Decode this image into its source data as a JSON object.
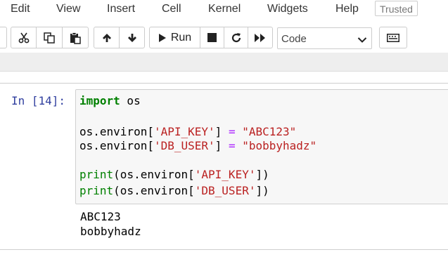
{
  "menu": {
    "items": [
      "Edit",
      "View",
      "Insert",
      "Cell",
      "Kernel",
      "Widgets",
      "Help"
    ],
    "trusted": "Trusted"
  },
  "toolbar": {
    "run_label": "Run",
    "cell_type": "Code",
    "icons": [
      "cut-icon",
      "copy-icon",
      "paste-icon",
      "move-up-icon",
      "move-down-icon",
      "run-icon",
      "stop-icon",
      "restart-icon",
      "fast-forward-icon",
      "keyboard-icon"
    ]
  },
  "cell": {
    "prompt": "In [14]:",
    "code": {
      "l1_kw": "import",
      "l1_rest": " os",
      "l2_a": "os.environ[",
      "l2_key": "'API_KEY'",
      "l2_b": "] ",
      "l2_eq": "=",
      "l2_sp": " ",
      "l2_val": "\"ABC123\"",
      "l3_a": "os.environ[",
      "l3_key": "'DB_USER'",
      "l3_b": "] ",
      "l3_eq": "=",
      "l3_sp": " ",
      "l3_val": "\"bobbyhadz\"",
      "l4_fn": "print",
      "l4_a": "(os.environ[",
      "l4_key": "'API_KEY'",
      "l4_b": "])",
      "l5_fn": "print",
      "l5_a": "(os.environ[",
      "l5_key": "'DB_USER'",
      "l5_b": "])"
    },
    "output": [
      "ABC123",
      "bobbyhadz"
    ]
  },
  "colors": {
    "keyword": "#008000",
    "string": "#ba2121",
    "operator": "#aa22ff",
    "prompt": "#303f9f",
    "cell_bg": "#f7f7f7"
  }
}
